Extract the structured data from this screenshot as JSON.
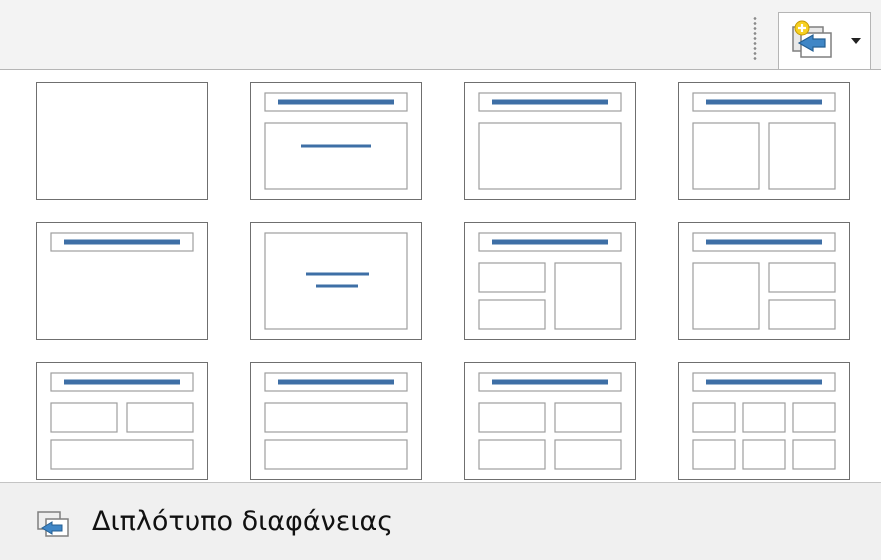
{
  "toolbar": {
    "grip_icon": "toolbar-grip-icon",
    "button_icon": "slide-layout-icon",
    "dropdown_icon": "dropdown-arrow-icon"
  },
  "layouts": [
    "blank",
    "title-content",
    "title-single-box",
    "title-two-columns",
    "title-only",
    "centered-text",
    "title-left-two-stacked-right-one",
    "title-left-one-right-two-stacked",
    "title-two-top-one-bottom",
    "title-two-rows",
    "title-four-boxes",
    "title-six-boxes"
  ],
  "menu": {
    "duplicate_slide_label": "Διπλότυπο διαφάνειας",
    "duplicate_slide_icon": "duplicate-slide-icon"
  },
  "colors": {
    "accent_line": "#3e6fa6",
    "placeholder_border": "#9e9e9e",
    "tile_border": "#6f6f6f"
  }
}
